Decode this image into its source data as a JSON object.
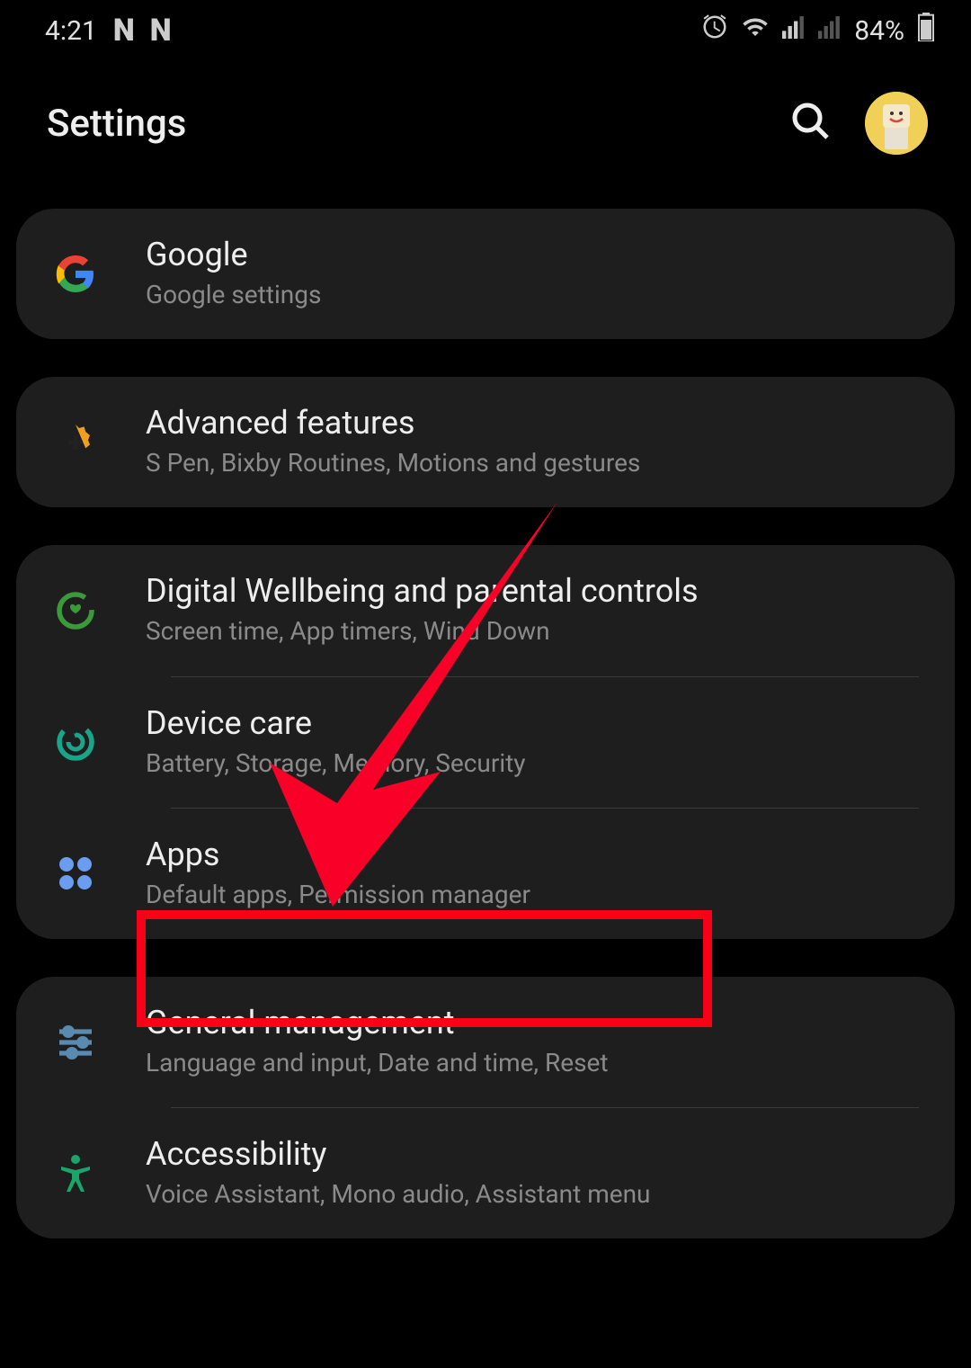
{
  "status_bar": {
    "time": "4:21",
    "battery": "84%",
    "notif_icons": [
      "N",
      "N"
    ]
  },
  "header": {
    "title": "Settings"
  },
  "groups": [
    {
      "items": [
        {
          "title": "Google",
          "subtitle": "Google settings",
          "icon": "google"
        }
      ]
    },
    {
      "items": [
        {
          "title": "Advanced features",
          "subtitle": "S Pen, Bixby Routines, Motions and gestures",
          "icon": "gear-plus"
        }
      ]
    },
    {
      "items": [
        {
          "title": "Digital Wellbeing and parental controls",
          "subtitle": "Screen time, App timers, Wind Down",
          "icon": "wellbeing"
        },
        {
          "title": "Device care",
          "subtitle": "Battery, Storage, Memory, Security",
          "icon": "device-care"
        },
        {
          "title": "Apps",
          "subtitle": "Default apps, Permission manager",
          "icon": "apps"
        }
      ]
    },
    {
      "items": [
        {
          "title": "General management",
          "subtitle": "Language and input, Date and time, Reset",
          "icon": "sliders"
        },
        {
          "title": "Accessibility",
          "subtitle": "Voice Assistant, Mono audio, Assistant menu",
          "icon": "accessibility"
        }
      ]
    }
  ],
  "annotation": {
    "highlight_target": "General management"
  }
}
